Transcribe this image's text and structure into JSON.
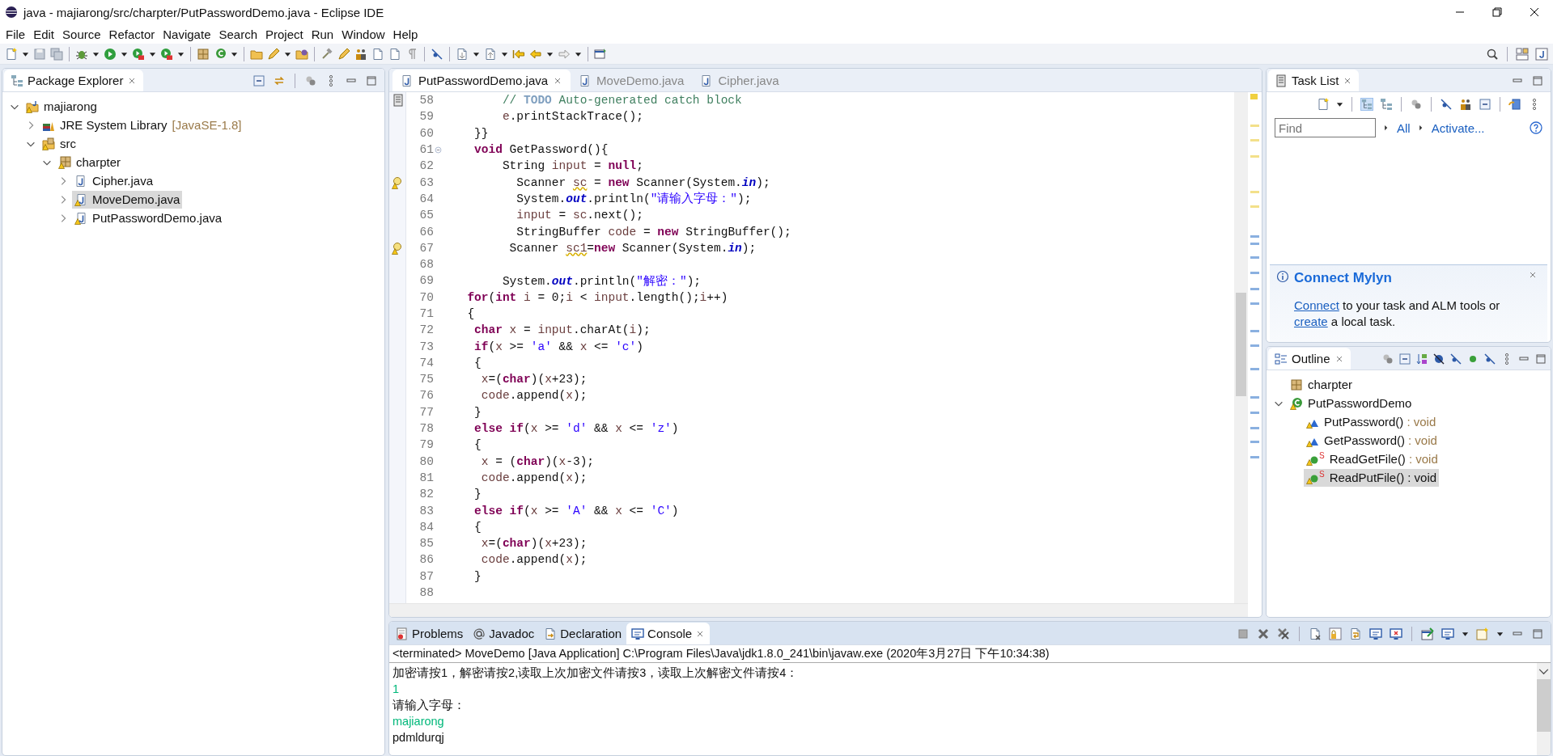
{
  "window": {
    "title": "java - majiarong/src/charpter/PutPasswordDemo.java - Eclipse IDE"
  },
  "menu": [
    "File",
    "Edit",
    "Source",
    "Refactor",
    "Navigate",
    "Search",
    "Project",
    "Run",
    "Window",
    "Help"
  ],
  "package_explorer": {
    "title": "Package Explorer",
    "items": [
      {
        "kind": "project",
        "label": "majiarong",
        "warning": true,
        "expanded": true,
        "selected": false,
        "children": [
          {
            "kind": "library",
            "label": "JRE System Library",
            "note": "[JavaSE-1.8]",
            "warning": false,
            "expanded": false,
            "selected": false
          },
          {
            "kind": "source_folder",
            "label": "src",
            "warning": true,
            "expanded": true,
            "selected": false,
            "children": [
              {
                "kind": "package",
                "label": "charpter",
                "warning": true,
                "expanded": true,
                "selected": false,
                "children": [
                  {
                    "kind": "java_file",
                    "label": "Cipher.java",
                    "warning": false,
                    "expanded": false,
                    "selected": false
                  },
                  {
                    "kind": "java_file",
                    "label": "MoveDemo.java",
                    "warning": true,
                    "expanded": false,
                    "selected": true
                  },
                  {
                    "kind": "java_file",
                    "label": "PutPasswordDemo.java",
                    "warning": true,
                    "expanded": false,
                    "selected": false
                  }
                ]
              }
            ]
          }
        ]
      }
    ]
  },
  "editor": {
    "tabs": [
      {
        "label": "PutPasswordDemo.java",
        "selected": true
      },
      {
        "label": "MoveDemo.java",
        "selected": false
      },
      {
        "label": "Cipher.java",
        "selected": false
      }
    ],
    "lines": [
      {
        "number": "58",
        "kind": "task",
        "tokens": [
          {
            "kind": "comment",
            "text": "       // "
          },
          {
            "kind": "todo",
            "text": "TODO"
          },
          {
            "kind": "comment",
            "text": " Auto-generated catch block"
          }
        ]
      },
      {
        "number": "59",
        "kind": "plain",
        "tokens": [
          {
            "kind": "local",
            "text": "       e"
          },
          {
            "kind": "plain",
            "text": ".printStackTrace();"
          }
        ]
      },
      {
        "number": "60",
        "kind": "plain",
        "tokens": [
          {
            "kind": "plain",
            "text": "   }}"
          }
        ]
      },
      {
        "number": "61",
        "kind": "fold",
        "tokens": [
          {
            "kind": "keyword",
            "text": "   void"
          },
          {
            "kind": "plain",
            "text": " GetPassword(){"
          }
        ]
      },
      {
        "number": "62",
        "kind": "plain",
        "tokens": [
          {
            "kind": "plain",
            "text": "       String "
          },
          {
            "kind": "local",
            "text": "input"
          },
          {
            "kind": "plain",
            "text": " = "
          },
          {
            "kind": "keyword",
            "text": "null"
          },
          {
            "kind": "plain",
            "text": ";"
          }
        ]
      },
      {
        "number": "63",
        "kind": "warning",
        "tokens": [
          {
            "kind": "plain",
            "text": "         Scanner "
          },
          {
            "kind": "local_warning",
            "text": "sc"
          },
          {
            "kind": "plain",
            "text": " = "
          },
          {
            "kind": "keyword",
            "text": "new"
          },
          {
            "kind": "plain",
            "text": " Scanner(System."
          },
          {
            "kind": "field",
            "text": "in"
          },
          {
            "kind": "plain",
            "text": ");"
          }
        ]
      },
      {
        "number": "64",
        "kind": "plain",
        "tokens": [
          {
            "kind": "plain",
            "text": "         System."
          },
          {
            "kind": "field",
            "text": "out"
          },
          {
            "kind": "plain",
            "text": ".println("
          },
          {
            "kind": "string",
            "text": "\"请输入字母：\""
          },
          {
            "kind": "plain",
            "text": ");"
          }
        ]
      },
      {
        "number": "65",
        "kind": "plain",
        "tokens": [
          {
            "kind": "local",
            "text": "         input"
          },
          {
            "kind": "plain",
            "text": " = "
          },
          {
            "kind": "local",
            "text": "sc"
          },
          {
            "kind": "plain",
            "text": ".next();"
          }
        ]
      },
      {
        "number": "66",
        "kind": "plain",
        "tokens": [
          {
            "kind": "plain",
            "text": "         StringBuffer "
          },
          {
            "kind": "local",
            "text": "code"
          },
          {
            "kind": "plain",
            "text": " = "
          },
          {
            "kind": "keyword",
            "text": "new"
          },
          {
            "kind": "plain",
            "text": " StringBuffer();"
          }
        ]
      },
      {
        "number": "67",
        "kind": "warning",
        "tokens": [
          {
            "kind": "plain",
            "text": "        Scanner "
          },
          {
            "kind": "local_warning",
            "text": "sc1"
          },
          {
            "kind": "plain",
            "text": "="
          },
          {
            "kind": "keyword",
            "text": "new"
          },
          {
            "kind": "plain",
            "text": " Scanner(System."
          },
          {
            "kind": "field",
            "text": "in"
          },
          {
            "kind": "plain",
            "text": ");"
          }
        ]
      },
      {
        "number": "68",
        "kind": "plain"
      },
      {
        "number": "69",
        "kind": "plain",
        "tokens": [
          {
            "kind": "plain",
            "text": "       System."
          },
          {
            "kind": "field",
            "text": "out"
          },
          {
            "kind": "plain",
            "text": ".println("
          },
          {
            "kind": "string",
            "text": "\"解密：\""
          },
          {
            "kind": "plain",
            "text": ");"
          }
        ]
      },
      {
        "number": "70",
        "kind": "plain",
        "tokens": [
          {
            "kind": "keyword",
            "text": "  for"
          },
          {
            "kind": "plain",
            "text": "("
          },
          {
            "kind": "keyword",
            "text": "int"
          },
          {
            "kind": "local",
            "text": " i"
          },
          {
            "kind": "plain",
            "text": " = 0;"
          },
          {
            "kind": "local",
            "text": "i"
          },
          {
            "kind": "plain",
            "text": " < "
          },
          {
            "kind": "local",
            "text": "input"
          },
          {
            "kind": "plain",
            "text": ".length();"
          },
          {
            "kind": "local",
            "text": "i"
          },
          {
            "kind": "plain",
            "text": "++)"
          }
        ]
      },
      {
        "number": "71",
        "kind": "plain",
        "tokens": [
          {
            "kind": "plain",
            "text": "  {"
          }
        ]
      },
      {
        "number": "72",
        "kind": "plain",
        "tokens": [
          {
            "kind": "keyword",
            "text": "   char"
          },
          {
            "kind": "local",
            "text": " x"
          },
          {
            "kind": "plain",
            "text": " = "
          },
          {
            "kind": "local",
            "text": "input"
          },
          {
            "kind": "plain",
            "text": ".charAt("
          },
          {
            "kind": "local",
            "text": "i"
          },
          {
            "kind": "plain",
            "text": ");"
          }
        ]
      },
      {
        "number": "73",
        "kind": "plain",
        "tokens": [
          {
            "kind": "keyword",
            "text": "   if"
          },
          {
            "kind": "plain",
            "text": "("
          },
          {
            "kind": "local",
            "text": "x"
          },
          {
            "kind": "plain",
            "text": " >= "
          },
          {
            "kind": "string",
            "text": "'a'"
          },
          {
            "kind": "plain",
            "text": " && "
          },
          {
            "kind": "local",
            "text": "x"
          },
          {
            "kind": "plain",
            "text": " <= "
          },
          {
            "kind": "string",
            "text": "'c'"
          },
          {
            "kind": "plain",
            "text": ")"
          }
        ]
      },
      {
        "number": "74",
        "kind": "plain",
        "tokens": [
          {
            "kind": "plain",
            "text": "   {"
          }
        ]
      },
      {
        "number": "75",
        "kind": "plain",
        "tokens": [
          {
            "kind": "local",
            "text": "    x"
          },
          {
            "kind": "plain",
            "text": "=("
          },
          {
            "kind": "keyword",
            "text": "char"
          },
          {
            "kind": "plain",
            "text": ")("
          },
          {
            "kind": "local",
            "text": "x"
          },
          {
            "kind": "plain",
            "text": "+23);"
          }
        ]
      },
      {
        "number": "76",
        "kind": "plain",
        "tokens": [
          {
            "kind": "local",
            "text": "    code"
          },
          {
            "kind": "plain",
            "text": ".append("
          },
          {
            "kind": "local",
            "text": "x"
          },
          {
            "kind": "plain",
            "text": ");"
          }
        ]
      },
      {
        "number": "77",
        "kind": "plain",
        "tokens": [
          {
            "kind": "plain",
            "text": "   }"
          }
        ]
      },
      {
        "number": "78",
        "kind": "plain",
        "tokens": [
          {
            "kind": "keyword",
            "text": "   else"
          },
          {
            "kind": "keyword",
            "text": " if"
          },
          {
            "kind": "plain",
            "text": "("
          },
          {
            "kind": "local",
            "text": "x"
          },
          {
            "kind": "plain",
            "text": " >= "
          },
          {
            "kind": "string",
            "text": "'d'"
          },
          {
            "kind": "plain",
            "text": " && "
          },
          {
            "kind": "local",
            "text": "x"
          },
          {
            "kind": "plain",
            "text": " <= "
          },
          {
            "kind": "string",
            "text": "'z'"
          },
          {
            "kind": "plain",
            "text": ")"
          }
        ]
      },
      {
        "number": "79",
        "kind": "plain",
        "tokens": [
          {
            "kind": "plain",
            "text": "   {"
          }
        ]
      },
      {
        "number": "80",
        "kind": "plain",
        "tokens": [
          {
            "kind": "local",
            "text": "    x"
          },
          {
            "kind": "plain",
            "text": " = ("
          },
          {
            "kind": "keyword",
            "text": "char"
          },
          {
            "kind": "plain",
            "text": ")("
          },
          {
            "kind": "local",
            "text": "x"
          },
          {
            "kind": "plain",
            "text": "-3);"
          }
        ]
      },
      {
        "number": "81",
        "kind": "plain",
        "tokens": [
          {
            "kind": "local",
            "text": "    code"
          },
          {
            "kind": "plain",
            "text": ".append("
          },
          {
            "kind": "local",
            "text": "x"
          },
          {
            "kind": "plain",
            "text": ");"
          }
        ]
      },
      {
        "number": "82",
        "kind": "plain",
        "tokens": [
          {
            "kind": "plain",
            "text": "   }"
          }
        ]
      },
      {
        "number": "83",
        "kind": "plain",
        "tokens": [
          {
            "kind": "keyword",
            "text": "   else"
          },
          {
            "kind": "keyword",
            "text": " if"
          },
          {
            "kind": "plain",
            "text": "("
          },
          {
            "kind": "local",
            "text": "x"
          },
          {
            "kind": "plain",
            "text": " >= "
          },
          {
            "kind": "string",
            "text": "'A'"
          },
          {
            "kind": "plain",
            "text": " && "
          },
          {
            "kind": "local",
            "text": "x"
          },
          {
            "kind": "plain",
            "text": " <= "
          },
          {
            "kind": "string",
            "text": "'C'"
          },
          {
            "kind": "plain",
            "text": ")"
          }
        ]
      },
      {
        "number": "84",
        "kind": "plain",
        "tokens": [
          {
            "kind": "plain",
            "text": "   {"
          }
        ]
      },
      {
        "number": "85",
        "kind": "plain",
        "tokens": [
          {
            "kind": "local",
            "text": "    x"
          },
          {
            "kind": "plain",
            "text": "=("
          },
          {
            "kind": "keyword",
            "text": "char"
          },
          {
            "kind": "plain",
            "text": ")("
          },
          {
            "kind": "local",
            "text": "x"
          },
          {
            "kind": "plain",
            "text": "+23);"
          }
        ]
      },
      {
        "number": "86",
        "kind": "plain",
        "tokens": [
          {
            "kind": "local",
            "text": "    code"
          },
          {
            "kind": "plain",
            "text": ".append("
          },
          {
            "kind": "local",
            "text": "x"
          },
          {
            "kind": "plain",
            "text": ");"
          }
        ]
      },
      {
        "number": "87",
        "kind": "plain",
        "tokens": [
          {
            "kind": "plain",
            "text": "   }"
          }
        ]
      },
      {
        "number": "88",
        "kind": "plain"
      }
    ]
  },
  "task_list": {
    "title": "Task List",
    "find": {
      "placeholder": "Find"
    },
    "links": [
      "All",
      "Activate..."
    ],
    "connect_mylyn": {
      "title": "Connect Mylyn",
      "parts": [
        {
          "kind": "link",
          "text": "Connect"
        },
        {
          "kind": "text",
          "text": " to your task and ALM tools or "
        },
        {
          "kind": "link",
          "text": "create"
        },
        {
          "kind": "text",
          "text": " a local task."
        }
      ]
    }
  },
  "outline": {
    "title": "Outline",
    "items": [
      {
        "kind": "package",
        "label": "charpter",
        "warning": false,
        "selected": false
      },
      {
        "kind": "class",
        "label": "PutPasswordDemo",
        "warning": true,
        "expanded": true,
        "selected": false,
        "children": [
          {
            "kind": "method_default",
            "label": "PutPassword()",
            "type": ": void",
            "warning": true,
            "selected": false
          },
          {
            "kind": "method_default",
            "label": "GetPassword()",
            "type": ": void",
            "warning": true,
            "selected": false
          },
          {
            "kind": "method_public",
            "label": "ReadGetFile()",
            "badge": "S",
            "type": ": void",
            "warning": true,
            "selected": false
          },
          {
            "kind": "method_public",
            "label": "ReadPutFile()",
            "badge": "S",
            "type": ": void",
            "warning": true,
            "selected": true
          }
        ]
      }
    ]
  },
  "console": {
    "tabs": [
      {
        "kind": "problems",
        "label": "Problems",
        "selected": false
      },
      {
        "kind": "javadoc",
        "label": "Javadoc",
        "selected": false
      },
      {
        "kind": "declaration",
        "label": "Declaration",
        "selected": false
      },
      {
        "kind": "console",
        "label": "Console",
        "selected": true
      }
    ],
    "status": "<terminated> MoveDemo [Java Application] C:\\Program Files\\Java\\jdk1.8.0_241\\bin\\javaw.exe (2020年3月27日 下午10:34:38)",
    "lines": [
      {
        "kind": "output",
        "text": "加密请按1，解密请按2,读取上次加密文件请按3，读取上次解密文件请按4："
      },
      {
        "kind": "input",
        "text": "1"
      },
      {
        "kind": "output",
        "text": "请输入字母："
      },
      {
        "kind": "input",
        "text": "majiarong"
      },
      {
        "kind": "output",
        "text": "pdmldurqj"
      }
    ]
  }
}
